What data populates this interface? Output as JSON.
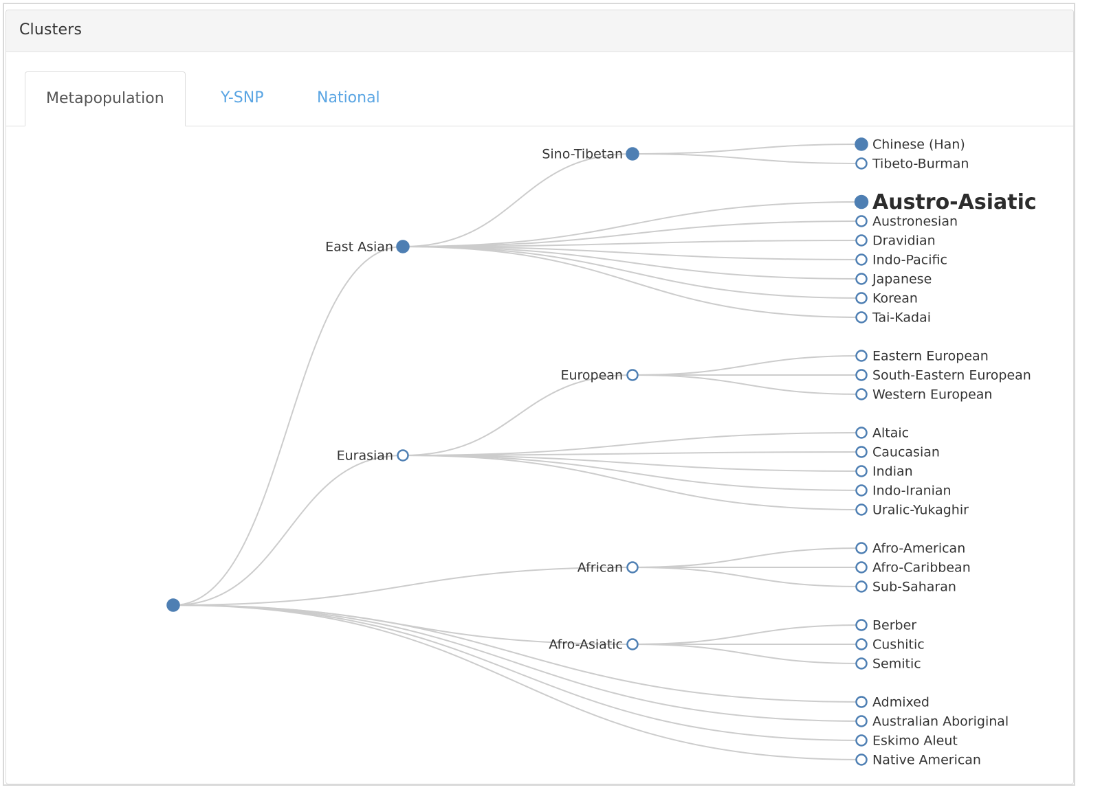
{
  "panel": {
    "title": "Clusters"
  },
  "tabs": [
    {
      "label": "Metapopulation",
      "active": true
    },
    {
      "label": "Y-SNP",
      "active": false
    },
    {
      "label": "National",
      "active": false
    }
  ],
  "colors": {
    "node": "#4e7fb3",
    "link": "#cccccc",
    "tab_link": "#5aa5e3",
    "label": "#333333"
  },
  "tree": {
    "name": "",
    "filled": true,
    "children": [
      {
        "name": "East Asian",
        "filled": true,
        "children": [
          {
            "name": "Sino-Tibetan",
            "filled": true,
            "children": [
              {
                "name": "Chinese (Han)",
                "filled": true
              },
              {
                "name": "Tibeto-Burman",
                "filled": false
              }
            ]
          },
          {
            "name": "Austro-Asiatic",
            "filled": true,
            "highlighted": true
          },
          {
            "name": "Austronesian",
            "filled": false
          },
          {
            "name": "Dravidian",
            "filled": false
          },
          {
            "name": "Indo-Pacific",
            "filled": false
          },
          {
            "name": "Japanese",
            "filled": false
          },
          {
            "name": "Korean",
            "filled": false
          },
          {
            "name": "Tai-Kadai",
            "filled": false
          }
        ]
      },
      {
        "name": "Eurasian",
        "filled": false,
        "children": [
          {
            "name": "European",
            "filled": false,
            "children": [
              {
                "name": "Eastern European",
                "filled": false
              },
              {
                "name": "South-Eastern European",
                "filled": false
              },
              {
                "name": "Western European",
                "filled": false
              }
            ]
          },
          {
            "name": "Altaic",
            "filled": false
          },
          {
            "name": "Caucasian",
            "filled": false
          },
          {
            "name": "Indian",
            "filled": false
          },
          {
            "name": "Indo-Iranian",
            "filled": false
          },
          {
            "name": "Uralic-Yukaghir",
            "filled": false
          }
        ]
      },
      {
        "name": "African",
        "filled": false,
        "children": [
          {
            "name": "Afro-American",
            "filled": false
          },
          {
            "name": "Afro-Caribbean",
            "filled": false
          },
          {
            "name": "Sub-Saharan",
            "filled": false
          }
        ]
      },
      {
        "name": "Afro-Asiatic",
        "filled": false,
        "children": [
          {
            "name": "Berber",
            "filled": false
          },
          {
            "name": "Cushitic",
            "filled": false
          },
          {
            "name": "Semitic",
            "filled": false
          }
        ]
      },
      {
        "name": "Admixed",
        "filled": false
      },
      {
        "name": "Australian Aboriginal",
        "filled": false
      },
      {
        "name": "Eskimo Aleut",
        "filled": false
      },
      {
        "name": "Native American",
        "filled": false
      }
    ]
  }
}
